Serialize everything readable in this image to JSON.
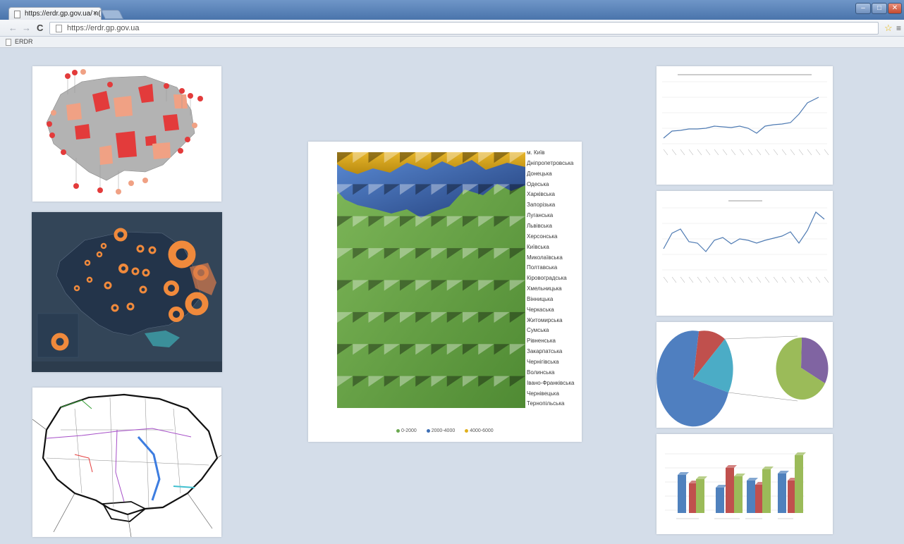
{
  "browser": {
    "tab_title": "https://erdr.gp.gov.ua/ n(",
    "tab_close": "×",
    "address": "https://erdr.gp.gov.ua",
    "bookmark": "ERDR",
    "icons": [
      "back-icon",
      "forward-icon",
      "reload-icon",
      "star-icon",
      "menu-icon"
    ]
  },
  "center_panel": {
    "regions": [
      "м. Київ",
      "Дніпропетровська",
      "Донецька",
      "Одеська",
      "Харківська",
      "Запорізька",
      "Луганська",
      "Львівська",
      "Херсонська",
      "Київська",
      "Миколаївська",
      "Полтавська",
      "Кіровоградська",
      "Хмельницька",
      "Вінницька",
      "Черкаська",
      "Житомирська",
      "Сумська",
      "Рівненська",
      "Закарпатська",
      "Чернігівська",
      "Волинська",
      "Івано-Франківська",
      "Чернівецька",
      "Тернопільська"
    ],
    "legend": [
      {
        "label": "0-2000",
        "color": "#6aa84f"
      },
      {
        "label": "2000-4000",
        "color": "#3f6fb5"
      },
      {
        "label": "4000-6000",
        "color": "#e0b01e"
      }
    ]
  },
  "colors": {
    "page_bg": "#d4dde9",
    "line_series": "#4f7bb3",
    "pie_blue": "#4f7fc0",
    "pie_red": "#c0504d",
    "pie_teal": "#4bacc6",
    "pie_green": "#9bbb59",
    "pie_purple": "#8064a2",
    "bar_blue": "#4f81bd",
    "bar_red": "#c0504d",
    "bar_green": "#9bbb59"
  }
}
